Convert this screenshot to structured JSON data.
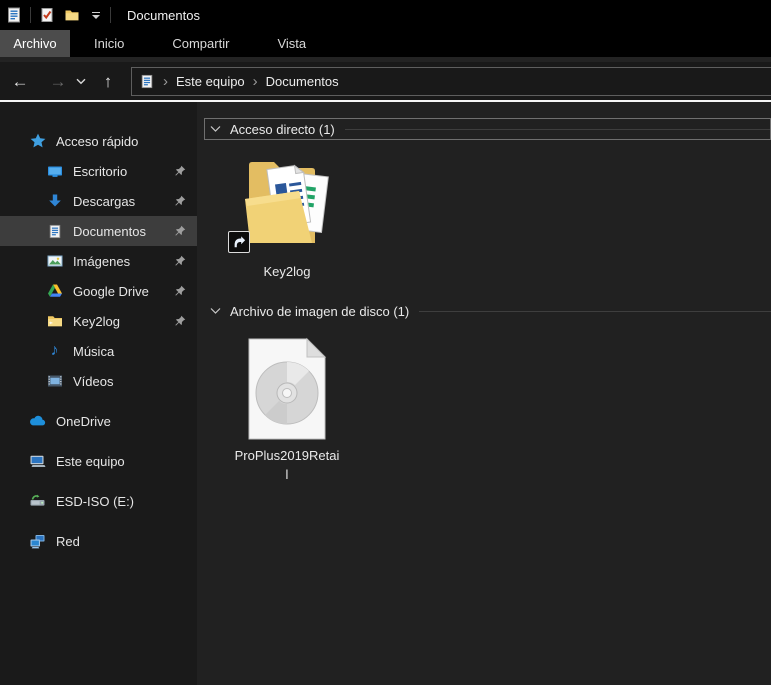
{
  "titlebar": {
    "title": "Documentos",
    "qat_icons": [
      "window-document-icon",
      "properties-check-icon",
      "new-folder-icon",
      "customize-qat-dropdown"
    ]
  },
  "ribbon": {
    "tabs": [
      {
        "label": "Archivo",
        "active": true
      },
      {
        "label": "Inicio",
        "active": false
      },
      {
        "label": "Compartir",
        "active": false
      },
      {
        "label": "Vista",
        "active": false
      }
    ]
  },
  "navbar": {
    "back_glyph": "←",
    "forward_glyph": "→",
    "up_glyph": "↑",
    "breadcrumb": {
      "root_icon": "document-icon",
      "items": [
        "Este equipo",
        "Documentos"
      ]
    }
  },
  "sidebar": {
    "items": [
      {
        "label": "Acceso rápido",
        "icon": "quick-access-star-icon",
        "level": 0,
        "pinned": false,
        "selected": false
      },
      {
        "label": "Escritorio",
        "icon": "desktop-icon",
        "level": 1,
        "pinned": true,
        "selected": false
      },
      {
        "label": "Descargas",
        "icon": "downloads-arrow-icon",
        "level": 1,
        "pinned": true,
        "selected": false
      },
      {
        "label": "Documentos",
        "icon": "documents-icon",
        "level": 1,
        "pinned": true,
        "selected": true
      },
      {
        "label": "Imágenes",
        "icon": "pictures-icon",
        "level": 1,
        "pinned": true,
        "selected": false
      },
      {
        "label": "Google Drive",
        "icon": "google-drive-icon",
        "level": 1,
        "pinned": true,
        "selected": false
      },
      {
        "label": "Key2log",
        "icon": "folder-icon",
        "level": 1,
        "pinned": true,
        "selected": false
      },
      {
        "label": "Música",
        "icon": "music-note-icon",
        "level": 1,
        "pinned": false,
        "selected": false
      },
      {
        "label": "Vídeos",
        "icon": "videos-film-icon",
        "level": 1,
        "pinned": false,
        "selected": false
      },
      {
        "label": "OneDrive",
        "icon": "onedrive-cloud-icon",
        "level": 0,
        "pinned": false,
        "selected": false
      },
      {
        "label": "Este equipo",
        "icon": "this-pc-icon",
        "level": 0,
        "pinned": false,
        "selected": false
      },
      {
        "label": "ESD-ISO (E:)",
        "icon": "drive-icon",
        "level": 0,
        "pinned": false,
        "selected": false
      },
      {
        "label": "Red",
        "icon": "network-icon",
        "level": 0,
        "pinned": false,
        "selected": false
      }
    ]
  },
  "main": {
    "groups": [
      {
        "title": "Acceso directo (1)",
        "items": [
          {
            "label": "Key2log",
            "type": "folder-shortcut"
          }
        ]
      },
      {
        "title": "Archivo de imagen de disco (1)",
        "items": [
          {
            "label": "ProPlus2019Retail",
            "label_line1": "ProPlus2019Retai",
            "label_line2": "l",
            "type": "disc-image"
          }
        ]
      }
    ]
  },
  "colors": {
    "titlebar_bg": "#000000",
    "chrome_bg": "#191919",
    "sidebar_bg": "#1a1a1a",
    "content_bg": "#212121",
    "active_tab_bg": "#4c4c4c",
    "selected_row_bg": "#3d3d3d",
    "text": "#e8e8e8",
    "white_separator": "#f5f5f5",
    "folder_yellow": "#eecb6d",
    "word_blue": "#2b579a",
    "excel_green": "#21a366",
    "onedrive_blue": "#1e8fdb",
    "accent_blue": "#2f86d6",
    "pin_gray": "#9e9e9e"
  }
}
